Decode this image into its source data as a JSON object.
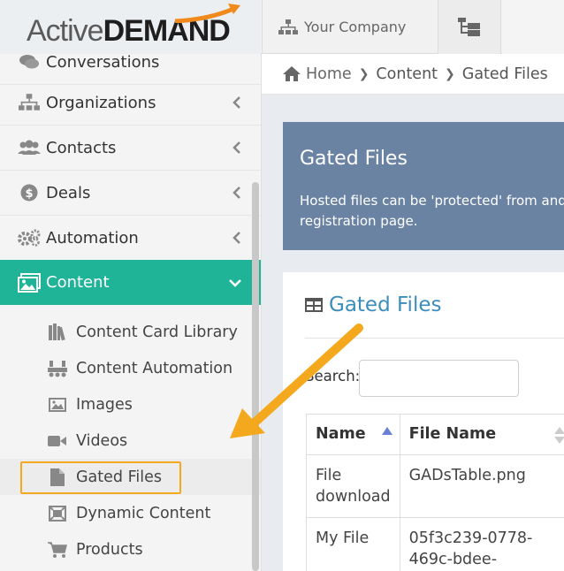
{
  "header": {
    "logo_active": "Active",
    "logo_demand": "DEMAND",
    "company_label": "Your Company",
    "company_icon": "sitemap-icon",
    "tree_icon": "tree-view-icon"
  },
  "sidebar": {
    "items": [
      {
        "label": "Conversations",
        "icon": "chat-icon"
      },
      {
        "label": "Organizations",
        "icon": "sitemap-icon"
      },
      {
        "label": "Contacts",
        "icon": "users-icon"
      },
      {
        "label": "Deals",
        "icon": "dollar-icon"
      },
      {
        "label": "Automation",
        "icon": "gears-icon"
      },
      {
        "label": "Content",
        "icon": "images-icon"
      }
    ],
    "sub_items": [
      {
        "label": "Content Card Library",
        "icon": "library-icon"
      },
      {
        "label": "Content Automation",
        "icon": "automation-icon"
      },
      {
        "label": "Images",
        "icon": "image-icon"
      },
      {
        "label": "Videos",
        "icon": "video-icon"
      },
      {
        "label": "Gated Files",
        "icon": "file-icon"
      },
      {
        "label": "Dynamic Content",
        "icon": "dynamic-content-icon"
      },
      {
        "label": "Products",
        "icon": "cart-icon"
      }
    ],
    "active_color": "#1fb497"
  },
  "breadcrumb": {
    "home": "Home",
    "content": "Content",
    "current": "Gated Files"
  },
  "banner": {
    "title": "Gated Files",
    "text": "Hosted files can be 'protected' from and registration page.",
    "color": "#6b83a3"
  },
  "panel": {
    "title": "Gated Files",
    "search_label": "Search:",
    "search_value": "",
    "columns": [
      "Name",
      "File Name"
    ],
    "rows": [
      {
        "name": "File download",
        "file": "GADsTable.png"
      },
      {
        "name": "My File",
        "file": "05f3c239-0778-469c-bdee-"
      }
    ]
  },
  "annotation": {
    "color": "#f4a81d"
  }
}
